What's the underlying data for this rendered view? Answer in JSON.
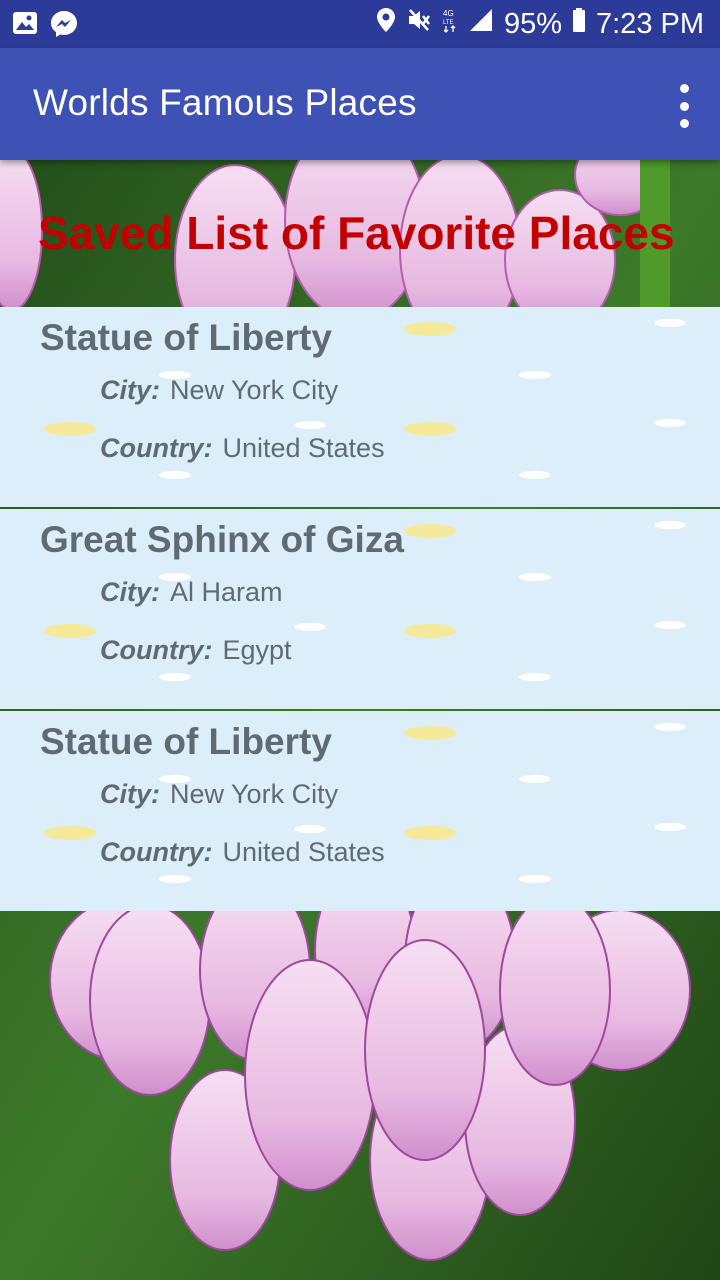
{
  "status_bar": {
    "battery": "95%",
    "time": "7:23 PM",
    "left_icons": [
      "image-icon",
      "messenger-icon"
    ],
    "right_icons": [
      "location-icon",
      "mute-icon",
      "data-4g-icon",
      "signal-icon",
      "battery-icon"
    ]
  },
  "app_bar": {
    "title": "Worlds Famous Places",
    "overflow_icon": "more-vert-icon"
  },
  "header": {
    "title": "Saved List of Favorite Places"
  },
  "places": [
    {
      "name": "Statue of Liberty",
      "city_label": "City:",
      "city": "New York City",
      "country_label": "Country:",
      "country": "United States"
    },
    {
      "name": "Great Sphinx of Giza",
      "city_label": "City:",
      "city": "Al Haram",
      "country_label": "Country:",
      "country": "Egypt"
    },
    {
      "name": "Statue of Liberty",
      "city_label": "City:",
      "city": "New York City",
      "country_label": "Country:",
      "country": "United States"
    }
  ],
  "colors": {
    "status_bar": "#2c3b98",
    "app_bar": "#3e51b5",
    "header_text": "#c30000",
    "card_bg": "#ddeefb",
    "card_text": "#5f6b73"
  }
}
